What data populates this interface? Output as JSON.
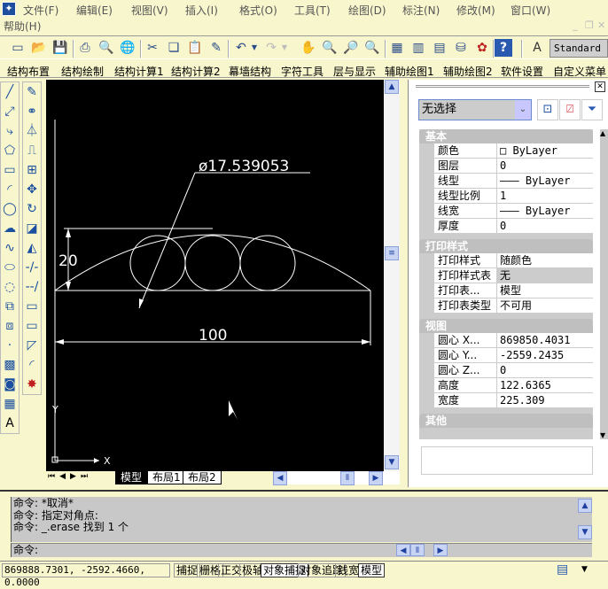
{
  "menubar": {
    "items": [
      "文件(F)",
      "编辑(E)",
      "视图(V)",
      "插入(I)",
      "格式(O)",
      "工具(T)",
      "绘图(D)",
      "标注(N)",
      "修改(M)",
      "窗口(W)",
      "帮助(H)"
    ]
  },
  "toolbar": {
    "text_style": "Standard"
  },
  "custom_menu": {
    "items": [
      "结构布置",
      "结构绘制",
      "结构计算1",
      "结构计算2",
      "幕墙结构",
      "字符工具",
      "层与显示",
      "辅助绘图1",
      "辅助绘图2",
      "软件设置",
      "自定义菜单"
    ]
  },
  "drawing": {
    "diameter_label": "ø17.539053",
    "height_label": "20",
    "width_label": "100",
    "ucs_x": "X",
    "ucs_y": "Y"
  },
  "layout_tabs": [
    "模型",
    "布局1",
    "布局2"
  ],
  "properties": {
    "selection": "无选择",
    "sections": [
      {
        "title": "基本",
        "rows": [
          {
            "key": "颜色",
            "value": "□ ByLayer"
          },
          {
            "key": "图层",
            "value": "0"
          },
          {
            "key": "线型",
            "value": "——— ByLayer"
          },
          {
            "key": "线型比例",
            "value": "1"
          },
          {
            "key": "线宽",
            "value": "——— ByLayer"
          },
          {
            "key": "厚度",
            "value": "0"
          }
        ]
      },
      {
        "title": "打印样式",
        "rows": [
          {
            "key": "打印样式",
            "value": "随颜色"
          },
          {
            "key": "打印样式表",
            "value": "无"
          },
          {
            "key": "打印表...",
            "value": "模型"
          },
          {
            "key": "打印表类型",
            "value": "不可用"
          }
        ]
      },
      {
        "title": "视图",
        "rows": [
          {
            "key": "圆心 X...",
            "value": "869850.4031"
          },
          {
            "key": "圆心 Y...",
            "value": "-2559.2435"
          },
          {
            "key": "圆心 Z...",
            "value": "0"
          },
          {
            "key": "高度",
            "value": "122.6365"
          },
          {
            "key": "宽度",
            "value": "225.309"
          }
        ]
      },
      {
        "title": "其他",
        "rows": []
      }
    ]
  },
  "command": {
    "history": [
      "命令: *取消*",
      "命令: 指定对角点:",
      "命令: _.erase 找到 1 个"
    ],
    "prompt": "命令:"
  },
  "status": {
    "coords": "869888.7301, -2592.4660, 0.0000",
    "buttons": [
      "捕捉",
      "栅格",
      "正交",
      "极轴",
      "对象捕捉",
      "对象追踪",
      "线宽",
      "模型"
    ]
  }
}
